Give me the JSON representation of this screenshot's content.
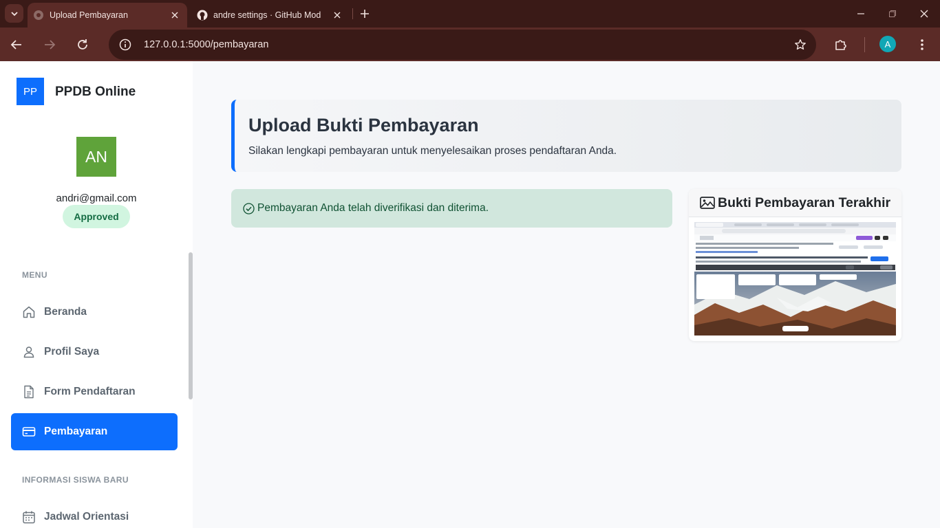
{
  "browser": {
    "tabs": [
      {
        "title": "Upload Pembayaran",
        "active": true
      },
      {
        "title": "andre settings · GitHub Mod",
        "active": false
      }
    ],
    "url": "127.0.0.1:5000/pembayaran",
    "profile_initial": "A"
  },
  "sidebar": {
    "brand_logo": "PP",
    "brand_name": "PPDB Online",
    "user": {
      "initials": "AN",
      "email": "andri@gmail.com",
      "status": "Approved"
    },
    "sections": [
      {
        "heading": "MENU",
        "items": [
          {
            "label": "Beranda",
            "icon": "home-icon",
            "active": false
          },
          {
            "label": "Profil Saya",
            "icon": "person-icon",
            "active": false
          },
          {
            "label": "Form Pendaftaran",
            "icon": "document-icon",
            "active": false
          },
          {
            "label": "Pembayaran",
            "icon": "credit-card-icon",
            "active": true
          }
        ]
      },
      {
        "heading": "INFORMASI SISWA BARU",
        "items": [
          {
            "label": "Jadwal Orientasi",
            "icon": "calendar-icon",
            "active": false
          }
        ]
      }
    ]
  },
  "main": {
    "header": {
      "title": "Upload Bukti Pembayaran",
      "subtitle": "Silakan lengkapi pembayaran untuk menyelesaikan proses pendaftaran Anda."
    },
    "alert": {
      "text": "Pembayaran Anda telah diverifikasi dan diterima."
    },
    "proof": {
      "title": "Bukti Pembayaran Terakhir"
    }
  },
  "colors": {
    "primary": "#0d6efd",
    "browser_frame": "#3a1a17",
    "browser_toolbar": "#5b2b27",
    "success_bg": "#d1e7dd",
    "success_text": "#0f5132",
    "avatar": "#5fa33a"
  }
}
